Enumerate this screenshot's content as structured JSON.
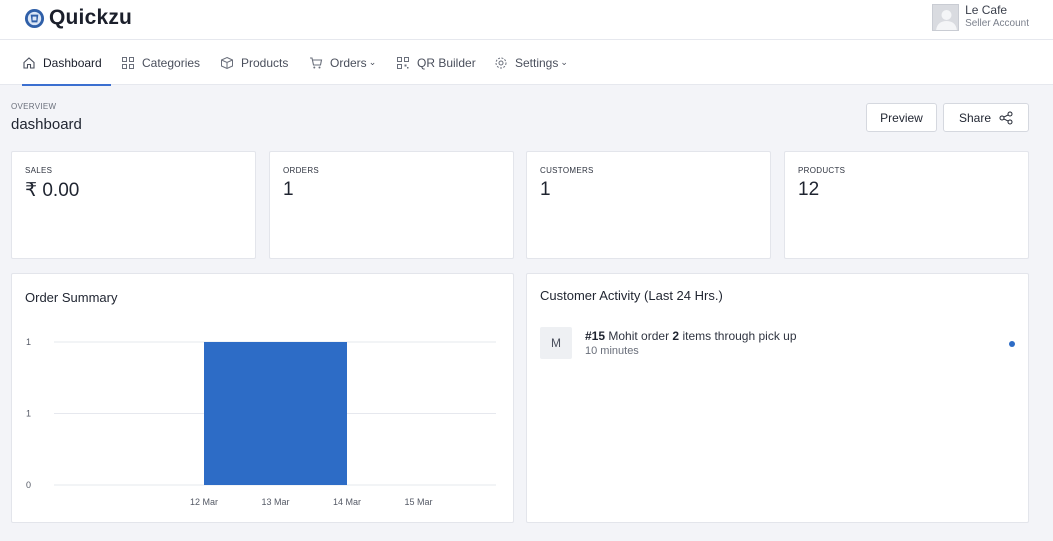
{
  "app": {
    "name": "Quickzu"
  },
  "user": {
    "name": "Le Cafe",
    "role": "Seller Account"
  },
  "nav": {
    "items": [
      {
        "label": "Dashboard",
        "icon": "home-icon"
      },
      {
        "label": "Categories",
        "icon": "grid-icon"
      },
      {
        "label": "Products",
        "icon": "box-icon"
      },
      {
        "label": "Orders",
        "icon": "cart-icon"
      },
      {
        "label": "QR Builder",
        "icon": "qr-icon"
      },
      {
        "label": "Settings",
        "icon": "gear-icon"
      }
    ]
  },
  "header": {
    "overline": "OVERVIEW",
    "title": "dashboard",
    "preview_label": "Preview",
    "share_label": "Share"
  },
  "stats": [
    {
      "label": "SALES",
      "value": "₹ 0.00"
    },
    {
      "label": "ORDERS",
      "value": "1"
    },
    {
      "label": "CUSTOMERS",
      "value": "1"
    },
    {
      "label": "PRODUCTS",
      "value": "12"
    }
  ],
  "order_summary": {
    "title": "Order Summary"
  },
  "chart_data": {
    "type": "bar",
    "categories": [
      "12 Mar",
      "13 Mar",
      "14 Mar",
      "15 Mar"
    ],
    "values": [
      1,
      1,
      0,
      0
    ],
    "ytick_labels": [
      "1",
      "1",
      "0"
    ],
    "ylim": [
      0,
      1
    ],
    "bar_color": "#2d6cc6",
    "grid": true
  },
  "activity": {
    "title": "Customer Activity (Last 24 Hrs.)",
    "items": [
      {
        "avatar": "M",
        "order": "#15",
        "prefix": "Mohit order",
        "count": "2",
        "suffix": "items through pick up",
        "time": "10 minutes"
      }
    ]
  },
  "colors": {
    "accent": "#3b6fd0",
    "bar": "#2d6cc6",
    "background": "#f3f4f8"
  }
}
